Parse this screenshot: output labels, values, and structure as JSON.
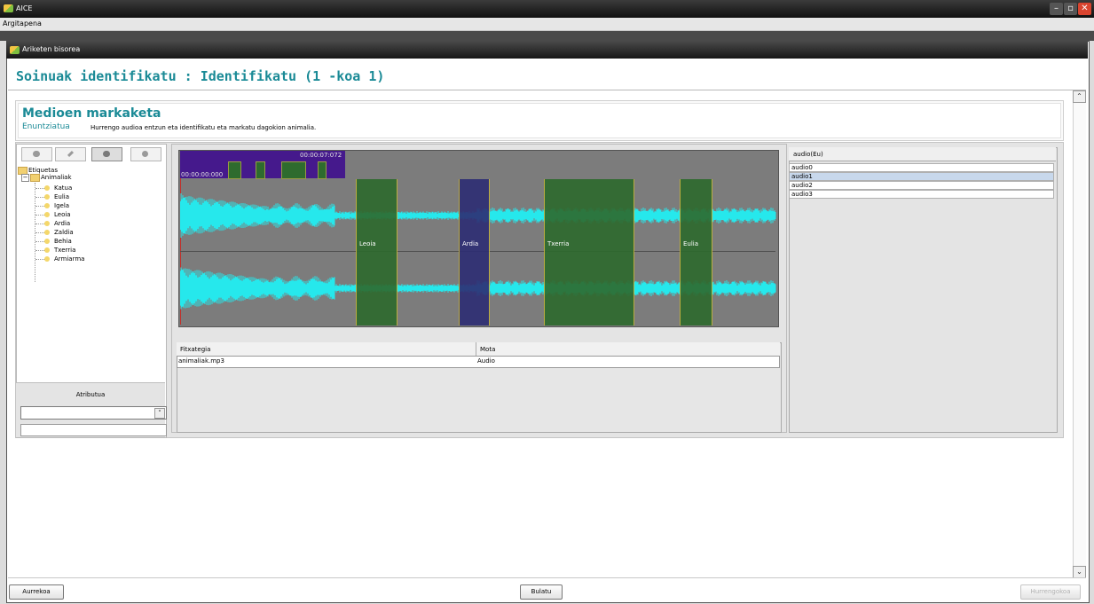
{
  "window": {
    "title": "AICE",
    "menu": "Argitapena",
    "inner_title": "Ariketen bisorea"
  },
  "page": {
    "title": "Soinuak identifikatu : Identifikatu (1 -koa 1)",
    "section_title": "Medioen markaketa",
    "statement_label": "Enuntziatua",
    "instruction": "Hurrengo audioa entzun eta identifikatu eta markatu dagokion animalia."
  },
  "tree": {
    "root": "Etiquetas",
    "group": "Animaliak",
    "items": [
      "Katua",
      "Eulia",
      "Igela",
      "Leoia",
      "Ardia",
      "Zaldia",
      "Behia",
      "Txerria",
      "Armiarma"
    ]
  },
  "attribute": {
    "label": "Atributua"
  },
  "timeline": {
    "start": "00:00:00:000",
    "cursor": "00:00:07:072"
  },
  "regions": [
    {
      "label": "Leoia",
      "selected": false
    },
    {
      "label": "Ardia",
      "selected": true
    },
    {
      "label": "Txerria",
      "selected": false
    },
    {
      "label": "Eulia",
      "selected": false
    }
  ],
  "file_table": {
    "headers": [
      "Fitxategia",
      "Mota"
    ],
    "rows": [
      [
        "animaliak.mp3",
        "Audio"
      ]
    ]
  },
  "audio_list": {
    "header": "audio(Eu)",
    "items": [
      "audio0",
      "audio1",
      "audio2",
      "audio3"
    ],
    "selected": "audio1"
  },
  "footer": {
    "prev": "Aurrekoa",
    "clear": "Bulatu",
    "next": "Hurrengokoa"
  },
  "colors": {
    "title_teal": "#1a8a96",
    "wave_cyan": "#26e8ec",
    "region_green": "#2d6a2d",
    "region_selected": "#2d2d74",
    "timeline_purple": "#45198c"
  }
}
